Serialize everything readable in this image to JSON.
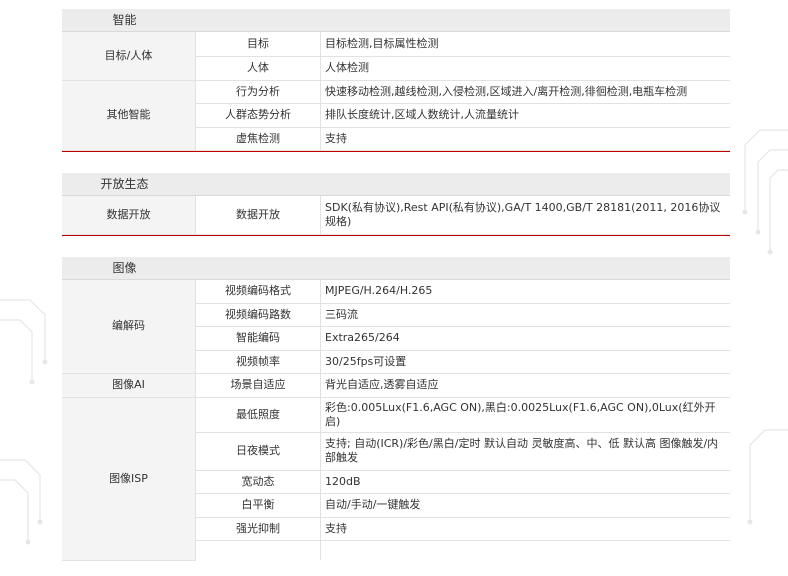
{
  "sections": [
    {
      "title": "智能",
      "rows": [
        {
          "category": "目标/人体",
          "span": 2,
          "item": "目标",
          "value": "目标检测,目标属性检测"
        },
        {
          "item": "人体",
          "value": "人体检测"
        },
        {
          "category": "其他智能",
          "span": 3,
          "item": "行为分析",
          "value": "快速移动检测,越线检测,入侵检测,区域进入/离开检测,徘徊检测,电瓶车检测"
        },
        {
          "item": "人群态势分析",
          "value": "排队长度统计,区域人数统计,人流量统计"
        },
        {
          "item": "虚焦检测",
          "value": "支持"
        }
      ]
    },
    {
      "title": "开放生态",
      "rows": [
        {
          "category": "数据开放",
          "span": 1,
          "item": "数据开放",
          "value": "SDK(私有协议),Rest API(私有协议),GA/T 1400,GB/T 28181(2011, 2016协议规格)"
        }
      ]
    },
    {
      "title": "图像",
      "rows": [
        {
          "category": "编解码",
          "span": 4,
          "item": "视频编码格式",
          "value": "MJPEG/H.264/H.265"
        },
        {
          "item": "视频编码路数",
          "value": "三码流"
        },
        {
          "item": "智能编码",
          "value": "Extra265/264"
        },
        {
          "item": "视频帧率",
          "value": "30/25fps可设置"
        },
        {
          "category": "图像AI",
          "span": 1,
          "item": "场景自适应",
          "value": "背光自适应,透雾自适应"
        },
        {
          "category": "图像ISP",
          "span": 6,
          "item": "最低照度",
          "value": "彩色:0.005Lux(F1.6,AGC ON),黑白:0.0025Lux(F1.6,AGC ON),0Lux(红外开启)"
        },
        {
          "item": "日夜模式",
          "value": "支持; 自动(ICR)/彩色/黑白/定时 默认自动 灵敏度高、中、低 默认高 图像触发/内部触发"
        },
        {
          "item": "宽动态",
          "value": "120dB"
        },
        {
          "item": "白平衡",
          "value": "自动/手动/一键触发"
        },
        {
          "item": "强光抑制",
          "value": "支持"
        },
        {
          "item": "",
          "value": ""
        }
      ]
    }
  ]
}
